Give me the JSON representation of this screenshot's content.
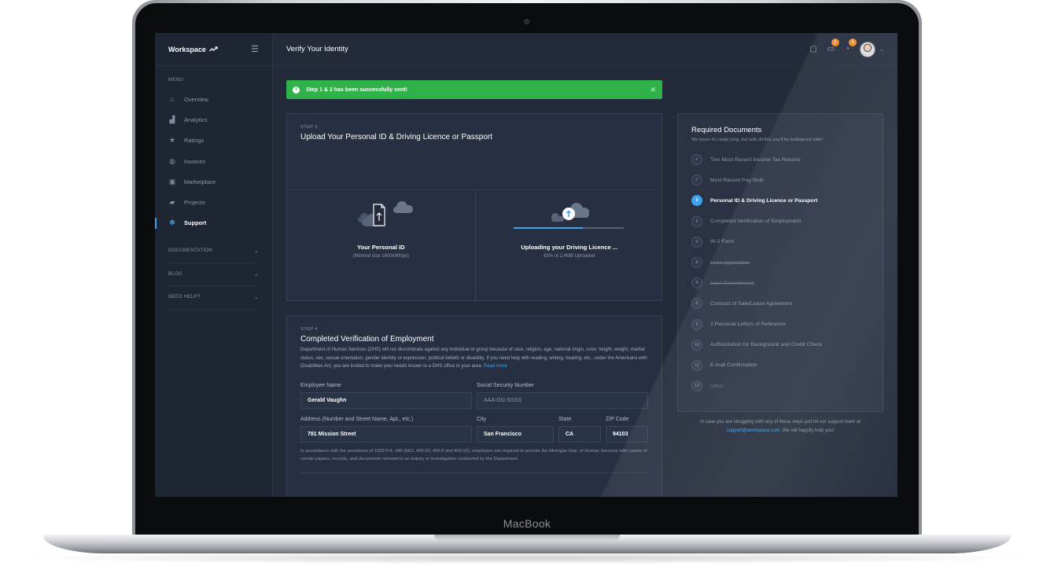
{
  "device": {
    "brand": "MacBook"
  },
  "sidebar": {
    "logo": "Workspace",
    "menu_heading": "MENU",
    "items": [
      {
        "label": "Overview",
        "icon": "home-icon"
      },
      {
        "label": "Analytics",
        "icon": "bar-chart-icon"
      },
      {
        "label": "Ratings",
        "icon": "star-icon"
      },
      {
        "label": "Invoices",
        "icon": "globe-icon"
      },
      {
        "label": "Marketplace",
        "icon": "briefcase-icon"
      },
      {
        "label": "Projects",
        "icon": "chat-icon"
      },
      {
        "label": "Support",
        "icon": "lifebuoy-icon",
        "active": true
      }
    ],
    "sections": [
      "DOCUMENTATION",
      "BLOG",
      "NEED HELP?"
    ]
  },
  "header": {
    "title": "Verify Your Identity",
    "notification_counts": [
      "2",
      "4"
    ]
  },
  "alert": {
    "text": "Step 1 & 2 has been successfully sent!"
  },
  "step3": {
    "label": "STEP 3",
    "title": "Upload Your Personal ID & Driving Licence or Passport",
    "left": {
      "title": "Your Personal ID",
      "sub": "(Minimal size 1600x900px)"
    },
    "right": {
      "title": "Uploading your Driving Licence ...",
      "sub": "63% of 2,4MB Uploaded",
      "progress": 0.63
    }
  },
  "step4": {
    "label": "STEP 4",
    "title": "Completed Verification of Employment",
    "description": "Department of Human Services (DHS) will not discriminate against any individual or group because of race, religion, age, national origin, color, height, weight, marital status, sex, sexual orientation, gender identity or expression, political beliefs or disability. If you need help with reading, writing, hearing, etc., under the Americans with Disabilities Act, you are invited to make your needs known to a DHS office in your area.",
    "read_more": "Read more",
    "fields": {
      "employee_name": {
        "label": "Employee Name",
        "value": "Gerald Vaughn"
      },
      "ssn": {
        "label": "Social Security Number",
        "placeholder": "AAA-GG-SSSS"
      },
      "address": {
        "label": "Address (Number and Street Name, Apt., etc.)",
        "value": "781 Mission Street"
      },
      "city": {
        "label": "City",
        "value": "San Francisco"
      },
      "state": {
        "label": "State",
        "value": "CA"
      },
      "zip": {
        "label": "ZIP Code",
        "value": "94103"
      }
    },
    "legal": "In accordance with the provisions of 1939 P.A. 280 (MCL 400.60, 400.8 and 400.63), employers are required to provide the Michigan Dep. of Human Services with copies of certain papers, records, and documents relevant to an inquiry or investigation conducted by the Department."
  },
  "required_documents": {
    "title": "Required Documents",
    "subtitle": "We know it's really long, but with all this you'll be bulletproof safe!",
    "items": [
      {
        "num": "✓",
        "label": "Two Most Recent Income Tax Returns",
        "state": "done"
      },
      {
        "num": "✓",
        "label": "Most Recent Pay Stub",
        "state": "done"
      },
      {
        "num": "3",
        "label": "Personal ID & Driving Licence or Passport",
        "state": "active"
      },
      {
        "num": "4",
        "label": "Completed Verification of Employment",
        "state": "pending"
      },
      {
        "num": "5",
        "label": "W-2 Form",
        "state": "pending"
      },
      {
        "num": "6",
        "label": "Loan Application",
        "state": "strike"
      },
      {
        "num": "7",
        "label": "Loan Commitment",
        "state": "strike"
      },
      {
        "num": "8",
        "label": "Contract of Sale/Lease Agreement",
        "state": "pending"
      },
      {
        "num": "9",
        "label": "2 Personal Letters of Reference",
        "state": "pending"
      },
      {
        "num": "10",
        "label": "Authorization for Background and Credit Check",
        "state": "pending"
      },
      {
        "num": "11",
        "label": "E-mail Confirmation",
        "state": "pending"
      },
      {
        "num": "12",
        "label": "Other",
        "state": "faded"
      }
    ]
  },
  "help": {
    "before": "In case you are struggling with any of these steps just hit our support team at",
    "email": "support@workspace.com",
    "after": ". We will happily help you!"
  },
  "colors": {
    "accent": "#3fa2f0",
    "success": "#2fb24a",
    "badge": "#f08a2e",
    "background": "#232b3b"
  }
}
